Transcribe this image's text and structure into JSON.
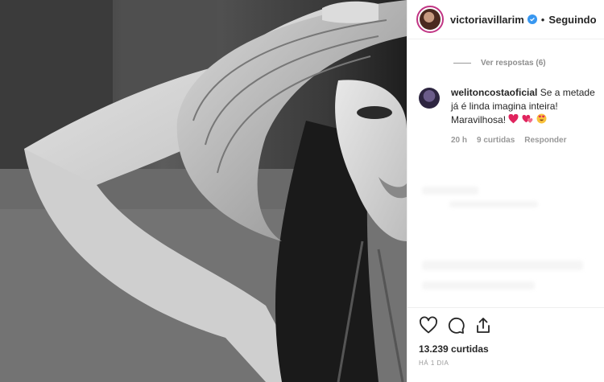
{
  "post": {
    "username": "victoriavillarim",
    "separator": "•",
    "follow_status": "Seguindo"
  },
  "comments": {
    "view_replies": "Ver respostas (6)",
    "items": [
      {
        "username": "welitoncostaoficial",
        "text": "Se a metade já é linda imagina inteira! Maravilhosa!",
        "emojis": [
          "heart-icon",
          "two-hearts-icon",
          "heart-eyes-emoji-icon"
        ],
        "time": "20 h",
        "likes": "9 curtidas",
        "reply": "Responder"
      }
    ]
  },
  "actions": {
    "icons": [
      "heart-outline-icon",
      "comment-icon",
      "share-icon"
    ],
    "likes": "13.239 curtidas",
    "date": "HÁ 1 DIA"
  },
  "colors": {
    "accent_blue": "#3897f0",
    "story_ring": "#c13584",
    "text": "#262626",
    "muted": "#8e8e8e"
  }
}
